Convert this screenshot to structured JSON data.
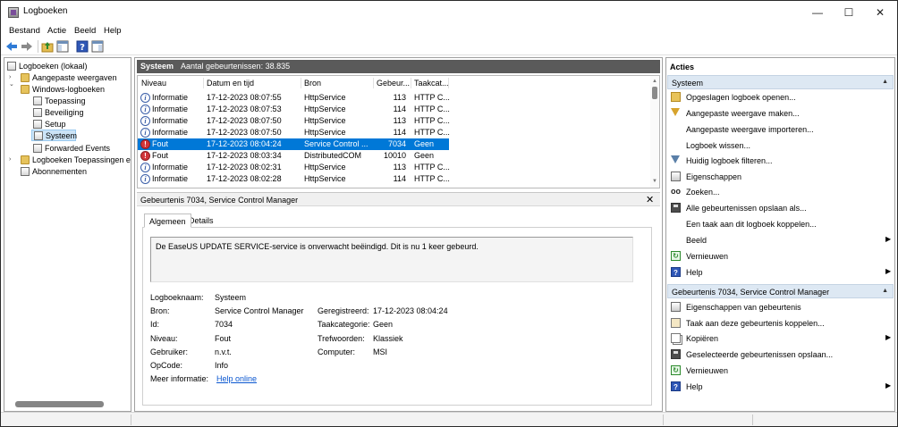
{
  "window": {
    "title": "Logboeken",
    "controls": {
      "minimize": "—",
      "maximize": "☐",
      "close": "✕"
    }
  },
  "menu": [
    "Bestand",
    "Actie",
    "Beeld",
    "Help"
  ],
  "toolbar": {
    "icons": [
      "back-arrow-icon",
      "forward-arrow-icon",
      "up-folder-icon",
      "show-hide-tree-icon",
      "help-icon",
      "show-hide-action-pane-icon"
    ]
  },
  "tree": {
    "items": [
      {
        "label": "Logboeken (lokaal)",
        "level": 0,
        "expander": ""
      },
      {
        "label": "Aangepaste weergaven",
        "level": 1,
        "expander": "›"
      },
      {
        "label": "Windows-logboeken",
        "level": 1,
        "expander": "⌄"
      },
      {
        "label": "Toepassing",
        "level": 2,
        "expander": ""
      },
      {
        "label": "Beveiliging",
        "level": 2,
        "expander": ""
      },
      {
        "label": "Setup",
        "level": 2,
        "expander": ""
      },
      {
        "label": "Systeem",
        "level": 2,
        "expander": "",
        "selected": true
      },
      {
        "label": "Forwarded Events",
        "level": 2,
        "expander": ""
      },
      {
        "label": "Logboeken Toepassingen en",
        "level": 1,
        "expander": "›"
      },
      {
        "label": "Abonnementen",
        "level": 1,
        "expander": ""
      }
    ]
  },
  "log": {
    "name": "Systeem",
    "count_label": "Aantal gebeurtenissen: 38.835"
  },
  "event_list": {
    "columns": [
      "Niveau",
      "Datum en tijd",
      "Bron",
      "Gebeur...",
      "Taakcat..."
    ],
    "rows": [
      {
        "level": "Informatie",
        "kind": "info",
        "datetime": "17-12-2023 08:07:55",
        "source": "HttpService",
        "id": "113",
        "task": "HTTP C..."
      },
      {
        "level": "Informatie",
        "kind": "info",
        "datetime": "17-12-2023 08:07:53",
        "source": "HttpService",
        "id": "114",
        "task": "HTTP C..."
      },
      {
        "level": "Informatie",
        "kind": "info",
        "datetime": "17-12-2023 08:07:50",
        "source": "HttpService",
        "id": "113",
        "task": "HTTP C..."
      },
      {
        "level": "Informatie",
        "kind": "info",
        "datetime": "17-12-2023 08:07:50",
        "source": "HttpService",
        "id": "114",
        "task": "HTTP C..."
      },
      {
        "level": "Fout",
        "kind": "error",
        "datetime": "17-12-2023 08:04:24",
        "source": "Service Control ...",
        "id": "7034",
        "task": "Geen",
        "selected": true
      },
      {
        "level": "Fout",
        "kind": "error",
        "datetime": "17-12-2023 08:03:34",
        "source": "DistributedCOM",
        "id": "10010",
        "task": "Geen"
      },
      {
        "level": "Informatie",
        "kind": "info",
        "datetime": "17-12-2023 08:02:31",
        "source": "HttpService",
        "id": "113",
        "task": "HTTP C..."
      },
      {
        "level": "Informatie",
        "kind": "info",
        "datetime": "17-12-2023 08:02:28",
        "source": "HttpService",
        "id": "114",
        "task": "HTTP C..."
      }
    ]
  },
  "details": {
    "title": "Gebeurtenis 7034, Service Control Manager",
    "close": "✕",
    "tabs": [
      "Algemeen",
      "Details"
    ],
    "message": "De EaseUS UPDATE SERVICE-service is onverwacht beëindigd. Dit is nu 1 keer gebeurd.",
    "labels": {
      "log_name": "Logboeknaam:",
      "source": "Bron:",
      "id": "Id:",
      "level": "Niveau:",
      "user": "Gebruiker:",
      "opcode": "OpCode:",
      "more_info": "Meer informatie:",
      "logged": "Geregistreerd:",
      "task_category": "Taakcategorie:",
      "keywords": "Trefwoorden:",
      "computer": "Computer:"
    },
    "values": {
      "log_name": "Systeem",
      "source": "Service Control Manager",
      "id": "7034",
      "level": "Fout",
      "user": "n.v.t.",
      "opcode": "Info",
      "more_info": "Help online",
      "logged": "17-12-2023 08:04:24",
      "task_category": "Geen",
      "keywords": "Klassiek",
      "computer": "MSI"
    }
  },
  "actions": {
    "header": "Acties",
    "section1": {
      "title": "Systeem",
      "items": [
        {
          "label": "Opgeslagen logboek openen...",
          "icon": "folder-open-icon"
        },
        {
          "label": "Aangepaste weergave maken...",
          "icon": "filter-icon"
        },
        {
          "label": "Aangepaste weergave importeren...",
          "icon": ""
        },
        {
          "label": "Logboek wissen...",
          "icon": ""
        },
        {
          "label": "Huidig logboek filteren...",
          "icon": "filter-icon"
        },
        {
          "label": "Eigenschappen",
          "icon": "properties-icon"
        },
        {
          "label": "Zoeken...",
          "icon": "find-icon"
        },
        {
          "label": "Alle gebeurtenissen opslaan als...",
          "icon": "save-icon"
        },
        {
          "label": "Een taak aan dit logboek koppelen...",
          "icon": ""
        },
        {
          "label": "Beeld",
          "icon": "",
          "submenu": true
        },
        {
          "label": "Vernieuwen",
          "icon": "refresh-icon"
        },
        {
          "label": "Help",
          "icon": "help-icon",
          "submenu": true
        }
      ]
    },
    "section2": {
      "title": "Gebeurtenis 7034, Service Control Manager",
      "items": [
        {
          "label": "Eigenschappen van gebeurtenis",
          "icon": "properties-icon"
        },
        {
          "label": "Taak aan deze gebeurtenis koppelen...",
          "icon": "task-icon"
        },
        {
          "label": "Kopiëren",
          "icon": "copy-icon",
          "submenu": true
        },
        {
          "label": "Geselecteerde gebeurtenissen opslaan...",
          "icon": "save-icon"
        },
        {
          "label": "Vernieuwen",
          "icon": "refresh-icon"
        },
        {
          "label": "Help",
          "icon": "help-icon",
          "submenu": true
        }
      ]
    }
  }
}
